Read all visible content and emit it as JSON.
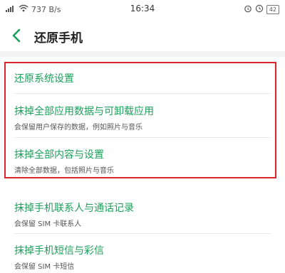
{
  "status_bar": {
    "signal": "📶",
    "wifi": "≋",
    "net_speed": "737 B/s",
    "time": "16:34",
    "icons": [
      "alarm-icon",
      "clock-icon"
    ],
    "battery": "42"
  },
  "header": {
    "title": "还原手机",
    "back_icon": "chevron-left-icon"
  },
  "items": [
    {
      "label": "还原系统设置",
      "desc": ""
    },
    {
      "label": "抹掉全部应用数据与可卸载应用",
      "desc": "会保留用户保存的数据，例如照片与音乐"
    },
    {
      "label": "抹掉全部内容与设置",
      "desc": "清除全部数据，包括照片与音乐"
    },
    {
      "label": "抹掉手机联系人与通话记录",
      "desc": "会保留 SIM 卡联系人"
    },
    {
      "label": "抹掉手机短信与彩信",
      "desc": "会保留 SIM 卡短信"
    }
  ],
  "colors": {
    "accent": "#1aa05a",
    "highlight_border": "#d9262c"
  }
}
